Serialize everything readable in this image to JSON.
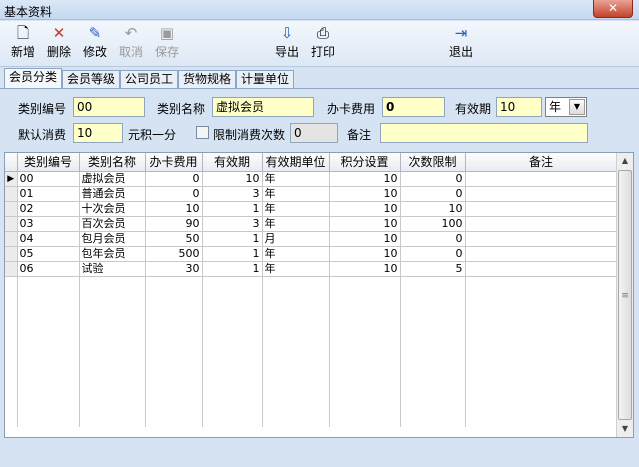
{
  "window": {
    "title": "基本资料",
    "close_label": "✕"
  },
  "toolbar": {
    "new": {
      "label": "新增",
      "icon": "new-doc-icon"
    },
    "delete": {
      "label": "删除",
      "icon": "delete-x-icon"
    },
    "edit": {
      "label": "修改",
      "icon": "edit-pen-icon"
    },
    "cancel": {
      "label": "取消",
      "icon": "undo-icon"
    },
    "save": {
      "label": "保存",
      "icon": "save-disk-icon"
    },
    "export": {
      "label": "导出",
      "icon": "export-icon"
    },
    "print": {
      "label": "打印",
      "icon": "printer-icon"
    },
    "exit": {
      "label": "退出",
      "icon": "exit-door-icon"
    }
  },
  "tabs": [
    "会员分类",
    "会员等级",
    "公司员工",
    "货物规格",
    "计量单位"
  ],
  "form": {
    "code_label": "类别编号",
    "code_value": "00",
    "name_label": "类别名称",
    "name_value": "虚拟会员",
    "fee_label": "办卡费用",
    "fee_value": "0",
    "validity_label": "有效期",
    "validity_value": "10",
    "validity_unit": "年",
    "default_spend_label": "默认消费",
    "default_spend_value": "10",
    "points_text": "元积一分",
    "limit_label": "限制消费次数",
    "limit_value": "0",
    "limit_checked": false,
    "remark_label": "备注",
    "remark_value": ""
  },
  "table": {
    "headers": [
      "类别编号",
      "类别名称",
      "办卡费用",
      "有效期",
      "有效期单位",
      "积分设置",
      "次数限制",
      "备注"
    ],
    "rows": [
      [
        "00",
        "虚拟会员",
        "0",
        "10",
        "年",
        "10",
        "0",
        ""
      ],
      [
        "01",
        "普通会员",
        "0",
        "3",
        "年",
        "10",
        "0",
        ""
      ],
      [
        "02",
        "十次会员",
        "10",
        "1",
        "年",
        "10",
        "10",
        ""
      ],
      [
        "03",
        "百次会员",
        "90",
        "3",
        "年",
        "10",
        "100",
        ""
      ],
      [
        "04",
        "包月会员",
        "50",
        "1",
        "月",
        "10",
        "0",
        ""
      ],
      [
        "05",
        "包年会员",
        "500",
        "1",
        "年",
        "10",
        "0",
        ""
      ],
      [
        "06",
        "试验",
        "30",
        "1",
        "年",
        "10",
        "5",
        ""
      ]
    ],
    "current_row_marker": "▶"
  }
}
